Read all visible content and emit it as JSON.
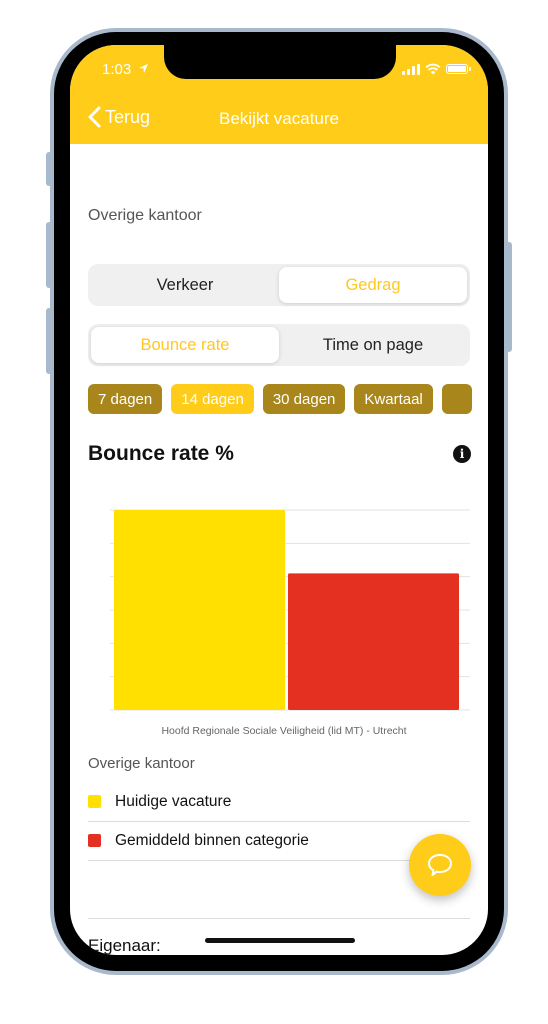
{
  "status_bar": {
    "time": "1:03"
  },
  "nav": {
    "back_label": "Terug",
    "title": "Bekijkt vacature"
  },
  "section_label": "Overige kantoor",
  "main_segment": {
    "options": [
      "Verkeer",
      "Gedrag"
    ],
    "selected": "Gedrag"
  },
  "metric_segment": {
    "options": [
      "Bounce rate",
      "Time on page"
    ],
    "selected": "Bounce rate"
  },
  "period_chips": {
    "options": [
      "7 dagen",
      "14 dagen",
      "30 dagen",
      "Kwartaal"
    ],
    "selected": "14 dagen"
  },
  "colors": {
    "accent": "#ffcc1a",
    "chip_inactive": "#a8861b",
    "series_current": "#ffe000",
    "series_average": "#e33020"
  },
  "chart_data": {
    "type": "bar",
    "title": "Bounce rate %",
    "xlabel": "Hoofd Regionale Sociale Veiligheid (lid MT) - Utrecht",
    "ylabel": "",
    "categories": [
      "Hoofd Regionale Sociale Veiligheid (lid MT) - Utrecht"
    ],
    "series": [
      {
        "name": "Huidige vacature",
        "color": "#ffe000",
        "values": [
          6
        ]
      },
      {
        "name": "Gemiddeld binnen categorie",
        "color": "#e33020",
        "values": [
          4.1
        ]
      }
    ],
    "ylim": [
      0,
      6
    ],
    "gridlines": 6,
    "grid": true,
    "y_tick_labels_visible": false,
    "legend_title": "Overige kantoor",
    "legend_position": "bottom"
  },
  "legend": {
    "title": "Overige kantoor",
    "items": [
      {
        "label": "Huidige vacature",
        "color": "#ffe000"
      },
      {
        "label": "Gemiddeld binnen categorie",
        "color": "#e33020"
      }
    ]
  },
  "owner_label": "Eigenaar:",
  "fab": {
    "icon": "chat-bubble-icon"
  }
}
